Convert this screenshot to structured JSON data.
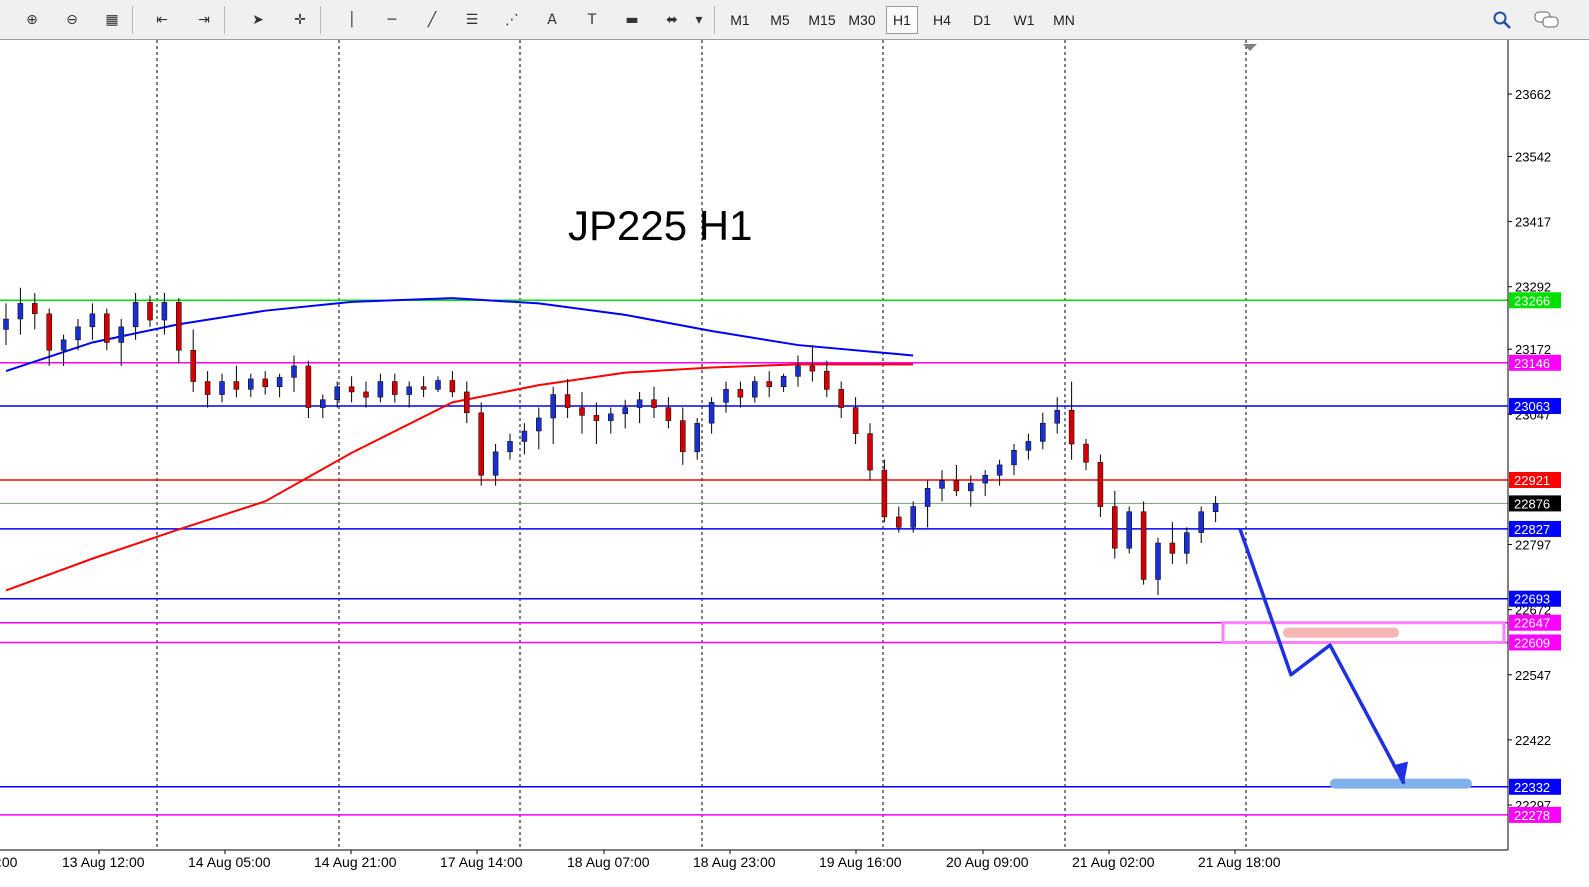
{
  "toolbar": {
    "tools": [
      {
        "name": "zoom-in-icon",
        "glyph": "⊕"
      },
      {
        "name": "zoom-out-icon",
        "glyph": "⊖"
      },
      {
        "name": "tile-windows-icon",
        "glyph": "▦"
      },
      {
        "name": "chart-shift-icon",
        "glyph": "⇤"
      },
      {
        "name": "autoscroll-icon",
        "glyph": "⇥"
      },
      {
        "name": "cursor-icon",
        "glyph": "➤"
      },
      {
        "name": "crosshair-icon",
        "glyph": "✛"
      },
      {
        "name": "vertical-line-icon",
        "glyph": "│"
      },
      {
        "name": "horizontal-line-icon",
        "glyph": "─"
      },
      {
        "name": "trendline-icon",
        "glyph": "╱"
      },
      {
        "name": "fibo-retracement-icon",
        "glyph": "☰"
      },
      {
        "name": "fibo-fan-icon",
        "glyph": "⋰"
      },
      {
        "name": "text-icon",
        "glyph": "A"
      },
      {
        "name": "text-label-icon",
        "glyph": "T"
      },
      {
        "name": "rectangle-icon",
        "glyph": "▬"
      },
      {
        "name": "arrows-icon",
        "glyph": "⬌"
      },
      {
        "name": "dropdown-icon",
        "glyph": "▾"
      }
    ],
    "timeframes": [
      "M1",
      "M5",
      "M15",
      "M30",
      "H1",
      "H4",
      "D1",
      "W1",
      "MN"
    ],
    "active_timeframe": "H1",
    "search_icon": "search-icon",
    "chat_icon": "chat-icon"
  },
  "chart_data": {
    "type": "candlestick",
    "title": "JP225 H1",
    "symbol": "JP225",
    "timeframe": "H1",
    "y_ticks": [
      23662,
      23542,
      23417,
      23292,
      23172,
      23047,
      22797,
      22672,
      22547,
      22422,
      22297
    ],
    "x_ticks": [
      "13 Aug 12:00",
      "14 Aug 05:00",
      "14 Aug 21:00",
      "17 Aug 14:00",
      "18 Aug 07:00",
      "18 Aug 23:00",
      "19 Aug 16:00",
      "20 Aug 09:00",
      "21 Aug 02:00",
      "21 Aug 18:00"
    ],
    "x_left_partial_label": ":00",
    "current_price": 22876,
    "horizontal_levels": [
      {
        "value": 23266,
        "color": "#00e000",
        "label": "23266"
      },
      {
        "value": 23146,
        "color": "#ff00ff",
        "label": "23146"
      },
      {
        "value": 23063,
        "color": "#0000ff",
        "label": "23063"
      },
      {
        "value": 22921,
        "color": "#ff0000",
        "label": "22921"
      },
      {
        "value": 22827,
        "color": "#0000ff",
        "label": "22827"
      },
      {
        "value": 22693,
        "color": "#0000ff",
        "label": "22693"
      },
      {
        "value": 22647,
        "color": "#ff00ff",
        "label": "22647"
      },
      {
        "value": 22609,
        "color": "#ff00ff",
        "label": "22609"
      },
      {
        "value": 22332,
        "color": "#0000ff",
        "label": "22332"
      },
      {
        "value": 22278,
        "color": "#ff00ff",
        "label": "22278"
      }
    ],
    "current_price_label": "22876",
    "moving_averages": [
      {
        "color": "#ff0000",
        "points": [
          [
            0,
            22709
          ],
          [
            12,
            22770
          ],
          [
            24,
            22826
          ],
          [
            36,
            22880
          ],
          [
            48,
            22973
          ],
          [
            62,
            23070
          ],
          [
            74,
            23103
          ],
          [
            86,
            23127
          ],
          [
            98,
            23137
          ],
          [
            110,
            23143
          ],
          [
            126,
            23143
          ]
        ]
      },
      {
        "color": "#0000ff",
        "points": [
          [
            0,
            23130
          ],
          [
            12,
            23185
          ],
          [
            24,
            23220
          ],
          [
            36,
            23246
          ],
          [
            48,
            23263
          ],
          [
            62,
            23270
          ],
          [
            74,
            23260
          ],
          [
            86,
            23238
          ],
          [
            98,
            23207
          ],
          [
            110,
            23180
          ],
          [
            126,
            23160
          ]
        ]
      }
    ],
    "candles": [
      [
        0,
        23210,
        23260,
        23180,
        23230
      ],
      [
        2,
        23230,
        23290,
        23200,
        23260
      ],
      [
        4,
        23260,
        23280,
        23210,
        23240
      ],
      [
        6,
        23240,
        23250,
        23140,
        23170
      ],
      [
        8,
        23170,
        23200,
        23140,
        23190
      ],
      [
        10,
        23190,
        23230,
        23170,
        23215
      ],
      [
        12,
        23215,
        23260,
        23190,
        23240
      ],
      [
        14,
        23240,
        23250,
        23170,
        23185
      ],
      [
        16,
        23185,
        23230,
        23140,
        23215
      ],
      [
        18,
        23215,
        23280,
        23190,
        23262
      ],
      [
        20,
        23262,
        23275,
        23215,
        23228
      ],
      [
        22,
        23228,
        23280,
        23200,
        23262
      ],
      [
        24,
        23262,
        23270,
        23145,
        23170
      ],
      [
        26,
        23170,
        23210,
        23090,
        23110
      ],
      [
        28,
        23110,
        23130,
        23060,
        23085
      ],
      [
        30,
        23085,
        23125,
        23070,
        23110
      ],
      [
        32,
        23110,
        23140,
        23080,
        23095
      ],
      [
        34,
        23095,
        23125,
        23080,
        23115
      ],
      [
        36,
        23115,
        23130,
        23085,
        23100
      ],
      [
        38,
        23100,
        23125,
        23080,
        23118
      ],
      [
        40,
        23118,
        23160,
        23090,
        23140
      ],
      [
        42,
        23140,
        23150,
        23040,
        23060
      ],
      [
        44,
        23060,
        23085,
        23040,
        23075
      ],
      [
        46,
        23075,
        23110,
        23060,
        23100
      ],
      [
        48,
        23100,
        23120,
        23070,
        23090
      ],
      [
        50,
        23090,
        23110,
        23060,
        23080
      ],
      [
        52,
        23080,
        23125,
        23070,
        23110
      ],
      [
        54,
        23110,
        23125,
        23070,
        23085
      ],
      [
        56,
        23085,
        23110,
        23060,
        23100
      ],
      [
        58,
        23100,
        23120,
        23080,
        23095
      ],
      [
        60,
        23095,
        23120,
        23090,
        23112
      ],
      [
        62,
        23112,
        23130,
        23080,
        23090
      ],
      [
        64,
        23090,
        23110,
        23030,
        23050
      ],
      [
        66,
        23050,
        23070,
        22910,
        22930
      ],
      [
        68,
        22930,
        22990,
        22910,
        22975
      ],
      [
        70,
        22975,
        23010,
        22960,
        22995
      ],
      [
        72,
        22995,
        23030,
        22970,
        23015
      ],
      [
        74,
        23015,
        23060,
        22980,
        23040
      ],
      [
        76,
        23040,
        23100,
        22990,
        23085
      ],
      [
        78,
        23085,
        23115,
        23040,
        23060
      ],
      [
        80,
        23060,
        23090,
        23010,
        23045
      ],
      [
        82,
        23045,
        23070,
        22990,
        23035
      ],
      [
        84,
        23035,
        23060,
        23010,
        23048
      ],
      [
        86,
        23048,
        23075,
        23020,
        23060
      ],
      [
        88,
        23060,
        23090,
        23030,
        23075
      ],
      [
        90,
        23075,
        23100,
        23040,
        23060
      ],
      [
        92,
        23060,
        23080,
        23020,
        23035
      ],
      [
        94,
        23035,
        23060,
        22950,
        22975
      ],
      [
        96,
        22975,
        23040,
        22960,
        23030
      ],
      [
        98,
        23030,
        23080,
        23010,
        23070
      ],
      [
        100,
        23070,
        23110,
        23050,
        23095
      ],
      [
        102,
        23095,
        23110,
        23060,
        23080
      ],
      [
        104,
        23080,
        23120,
        23070,
        23110
      ],
      [
        106,
        23110,
        23130,
        23080,
        23100
      ],
      [
        108,
        23100,
        23125,
        23090,
        23120
      ],
      [
        110,
        23120,
        23160,
        23100,
        23140
      ],
      [
        112,
        23140,
        23180,
        23110,
        23130
      ],
      [
        114,
        23130,
        23150,
        23080,
        23095
      ],
      [
        116,
        23095,
        23110,
        23040,
        23060
      ],
      [
        118,
        23060,
        23080,
        22990,
        23010
      ],
      [
        120,
        23010,
        23030,
        22920,
        22940
      ],
      [
        122,
        22940,
        22960,
        22840,
        22850
      ],
      [
        124,
        22850,
        22870,
        22820,
        22830
      ],
      [
        126,
        22830,
        22880,
        22820,
        22870
      ],
      [
        128,
        22870,
        22920,
        22830,
        22905
      ],
      [
        130,
        22905,
        22940,
        22880,
        22920
      ],
      [
        132,
        22920,
        22950,
        22890,
        22900
      ],
      [
        134,
        22900,
        22930,
        22870,
        22915
      ],
      [
        136,
        22915,
        22940,
        22890,
        22930
      ],
      [
        138,
        22930,
        22960,
        22910,
        22950
      ],
      [
        140,
        22950,
        22990,
        22930,
        22978
      ],
      [
        142,
        22978,
        23010,
        22960,
        22995
      ],
      [
        144,
        22995,
        23050,
        22980,
        23030
      ],
      [
        146,
        23030,
        23080,
        23010,
        23055
      ],
      [
        148,
        23055,
        23110,
        22960,
        22990
      ],
      [
        150,
        22990,
        23000,
        22940,
        22955
      ],
      [
        152,
        22955,
        22970,
        22850,
        22870
      ],
      [
        154,
        22870,
        22900,
        22770,
        22790
      ],
      [
        156,
        22790,
        22870,
        22780,
        22860
      ],
      [
        158,
        22860,
        22880,
        22720,
        22730
      ],
      [
        160,
        22730,
        22810,
        22700,
        22800
      ],
      [
        162,
        22800,
        22840,
        22760,
        22780
      ],
      [
        164,
        22780,
        22830,
        22760,
        22820
      ],
      [
        166,
        22820,
        22870,
        22800,
        22860
      ],
      [
        168,
        22860,
        22890,
        22840,
        22876
      ]
    ],
    "annotations": [
      {
        "type": "rectangle",
        "color": "#ff80ff",
        "from": [
          22647,
          22609
        ]
      },
      {
        "type": "zone",
        "color": "#f4b5b5",
        "value": 22628
      },
      {
        "type": "zone",
        "color": "#7fb2ea",
        "value": 22338
      },
      {
        "type": "arrow",
        "color": "#1f30e0",
        "points": [
          [
            22827
          ],
          [
            22547
          ],
          [
            22604
          ],
          [
            22338
          ]
        ]
      }
    ]
  }
}
